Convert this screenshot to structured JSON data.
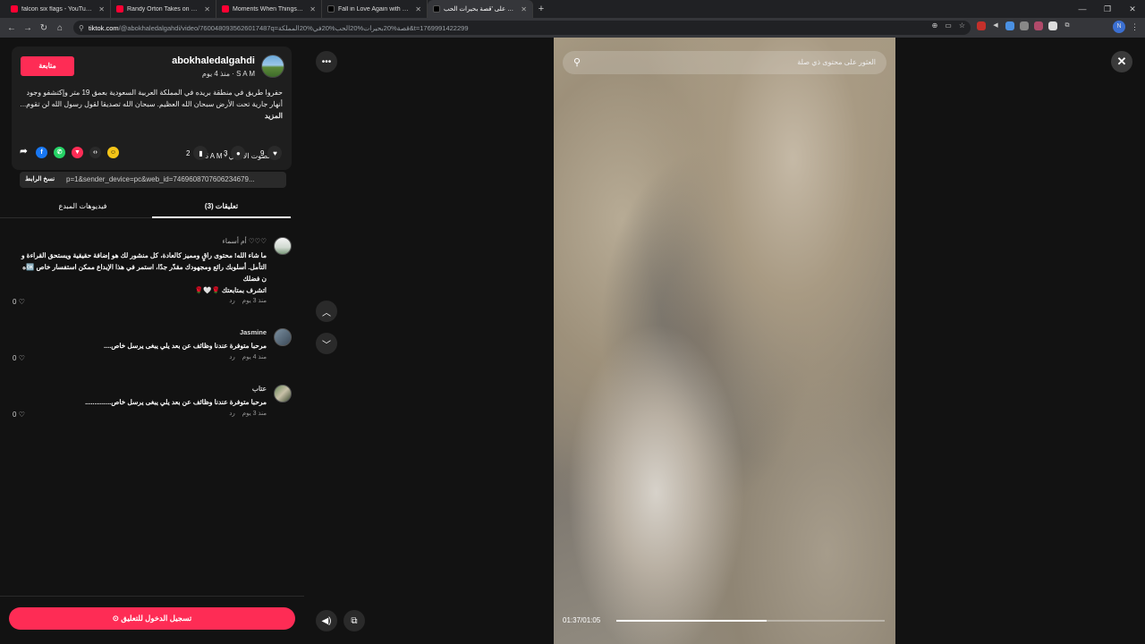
{
  "browser": {
    "tabs": [
      {
        "title": "falcon six flags - YouTube",
        "favicon": "youtube-icon",
        "active": false
      },
      {
        "title": "Randy Orton Takes on the Iron",
        "favicon": "youtube-icon",
        "active": false
      },
      {
        "title": "Moments When Things Went W",
        "favicon": "youtube-icon",
        "active": false
      },
      {
        "title": "Fall in Love Again with Cyberp",
        "favicon": "tiktok-icon",
        "active": false
      },
      {
        "title": "انظر على 'قصة بحيرات الحب",
        "favicon": "tiktok-icon",
        "active": true
      }
    ],
    "url_host": "tiktok.com",
    "url_path": "/@abokhaledalgahdi/video/7600480935626017487q=قصة%20بحيرات%20الحب%20في%20المملكة&t=1769991422299",
    "profile_initial": "N"
  },
  "post": {
    "follow_label": "متابعة",
    "author": "abokhaledalgahdi",
    "author_sub": "S A M · منذ 4 يوم",
    "description": "حفروا طريق في منطقة بريده في المملكة العربية السعودية بعمق 19 متر وإكتشفو وجود أنهار جارية تحت الأرض سبحان الله العظيم. سبحان الله تصديقا لقول رسول الله لن تقوم...",
    "more_label": "المزيد",
    "sound": "الصوت الأصلي - S A M",
    "likes": "9",
    "comments": "3",
    "saves": "2",
    "link": "p=1&sender_device=pc&web_id=7469608707606234679...",
    "copy_label": "نسخ الرابط"
  },
  "tabs": {
    "comments": "تعليقات (3)",
    "creator_videos": "فيديوهات المبدع"
  },
  "comments": [
    {
      "name": "♡♡♡ أم أسماء",
      "lines": [
        "ما شاء الله! محتوى راقٍ ومميز كالعادة، كل منشور لك هو إضافة حقيقية ويستحق القراءة و",
        "التأمل. أسلوبك رائع ومجهودك مقدّر جدًا، استمر في هذا الإبداع ممكن استفسار خاص 🆗ه",
        "ن فضلك",
        "اتشرف بمتابعتك 🌹🤍🌹"
      ],
      "time": "منذ 3 يوم",
      "reply": "رد",
      "likes": "0"
    },
    {
      "name": "Jasmine",
      "lines": [
        "مرحبا متوفرة عندنا وظائف عن بعد يلي يبغى يرسل خاص...."
      ],
      "time": "منذ 4 يوم",
      "reply": "رد",
      "likes": "0"
    },
    {
      "name": "عتاب",
      "lines": [
        "مرحبا متوفرة عندنا وظائف عن بعد يلي يبغى يرسل خاص.............."
      ],
      "time": "منذ 3 يوم",
      "reply": "رد",
      "likes": "0"
    }
  ],
  "login": {
    "label": "تسجيل الدخول للتعليق"
  },
  "video": {
    "search_placeholder": "العثور على محتوى ذي صلة",
    "time": "01:37/01:05",
    "progress": 0.56
  }
}
